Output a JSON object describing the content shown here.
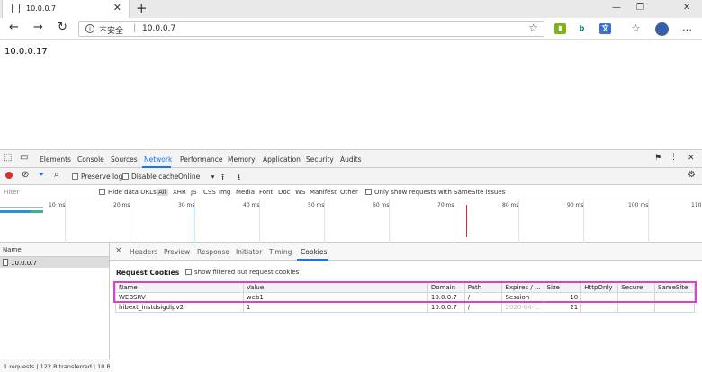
{
  "browser": {
    "tab_title": "10.0.0.7",
    "tab_close": "✕",
    "new_tab": "+",
    "window_controls": {
      "minimize": "—",
      "maximize": "❐",
      "close": "✕"
    },
    "nav": {
      "back": "←",
      "forward": "→",
      "refresh": "↻"
    },
    "address": {
      "security": "不安全",
      "separator": "|",
      "url": "10.0.0.7"
    },
    "extensions": [
      {
        "icon": "extension-green-icon",
        "color": "#7cb518",
        "glyph": "▮"
      },
      {
        "icon": "bing-icon",
        "color": "#008373",
        "glyph": "b"
      },
      {
        "icon": "translate-icon",
        "color": "#3b6fd8",
        "glyph": "文"
      },
      {
        "icon": "favorites-icon",
        "color": "#444444",
        "glyph": "☆"
      },
      {
        "icon": "collections-icon",
        "color": "#444444",
        "glyph": "▣"
      }
    ],
    "more": "…"
  },
  "page": {
    "text": "10.0.0.17"
  },
  "devtools": {
    "tabs": [
      "Elements",
      "Console",
      "Sources",
      "Network",
      "Performance",
      "Memory",
      "Application",
      "Security",
      "Audits"
    ],
    "active_tab": "Network",
    "toolbar": {
      "preserve_log": "Preserve log",
      "disable_cache": "Disable cache",
      "throttling": "Online"
    },
    "filter": {
      "placeholder": "Filter",
      "hide_data_urls": "Hide data URLs",
      "types": [
        "All",
        "XHR",
        "JS",
        "CSS",
        "Img",
        "Media",
        "Font",
        "Doc",
        "WS",
        "Manifest",
        "Other"
      ],
      "samesite_label": "Only show requests with SameSite issues"
    },
    "timeline": {
      "ticks": [
        "10 ms",
        "20 ms",
        "30 ms",
        "40 ms",
        "50 ms",
        "60 ms",
        "70 ms",
        "80 ms",
        "90 ms",
        "100 ms",
        "110"
      ],
      "bar_colors": {
        "waiting": "#2b90d9",
        "receiving": "#3fb08a"
      },
      "dom_marker_color": "#2b7bd9",
      "load_marker_color": "#d32f2f"
    },
    "name_pane": {
      "header": "Name",
      "rows": [
        "10.0.0.7"
      ],
      "status": "1 requests | 122 B transferred | 10 B"
    },
    "detail": {
      "close": "×",
      "tabs": [
        "Headers",
        "Preview",
        "Response",
        "Initiator",
        "Timing",
        "Cookies"
      ],
      "active_tab": "Cookies",
      "section_title": "Request Cookies",
      "show_filtered": "show filtered out request cookies",
      "columns": [
        "Name",
        "Value",
        "Domain",
        "Path",
        "Expires / ...",
        "Size",
        "HttpOnly",
        "Secure",
        "SameSite"
      ],
      "rows": [
        {
          "name": "WEBSRV",
          "value": "web1",
          "domain": "10.0.0.7",
          "path": "/",
          "expires": "Session",
          "size": "10",
          "httponly": "",
          "secure": "",
          "samesite": ""
        },
        {
          "name": "hibext_instdsigdipv2",
          "value": "1",
          "domain": "10.0.0.7",
          "path": "/",
          "expires": "2020-04-...",
          "size": "21",
          "httponly": "",
          "secure": "",
          "samesite": ""
        }
      ],
      "highlight_color": "#e040c8"
    }
  }
}
